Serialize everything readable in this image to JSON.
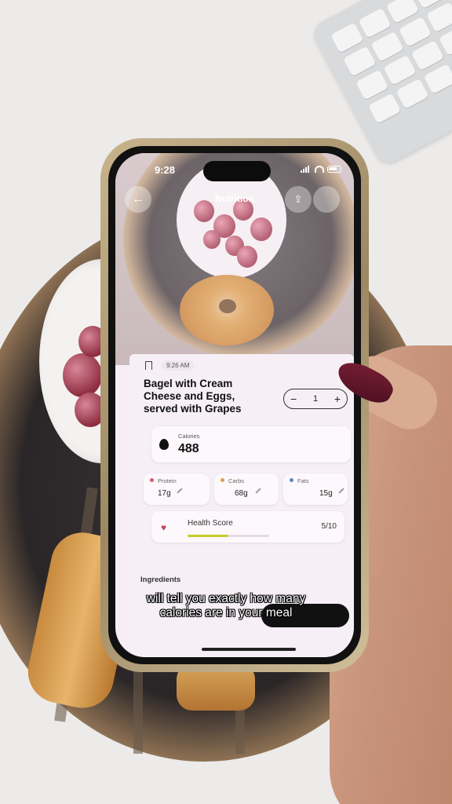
{
  "status_bar": {
    "time": "9:28"
  },
  "header": {
    "title": "Nutrition",
    "back_icon": "arrow-left-icon",
    "share_icon": "share-icon",
    "more_icon": "more-icon"
  },
  "meal": {
    "logged_time": "9:26 AM",
    "name": "Bagel with Cream Cheese and Eggs, served with Grapes",
    "quantity": "1",
    "minus": "−",
    "plus": "+"
  },
  "calories": {
    "label": "Calories",
    "value": "488"
  },
  "macros": [
    {
      "label": "Protein",
      "value": "17g",
      "color": "#d95a6e"
    },
    {
      "label": "Carbs",
      "value": "68g",
      "color": "#d9a244"
    },
    {
      "label": "Fats",
      "value": "15g",
      "color": "#5f86c4"
    }
  ],
  "health_score": {
    "label": "Health Score",
    "value": "5/10",
    "fraction": 0.5,
    "bar_color": "#c9cc2e"
  },
  "ingredients": {
    "label": "Ingredients"
  },
  "caption": "will tell you exactly how many calories are in your meal"
}
